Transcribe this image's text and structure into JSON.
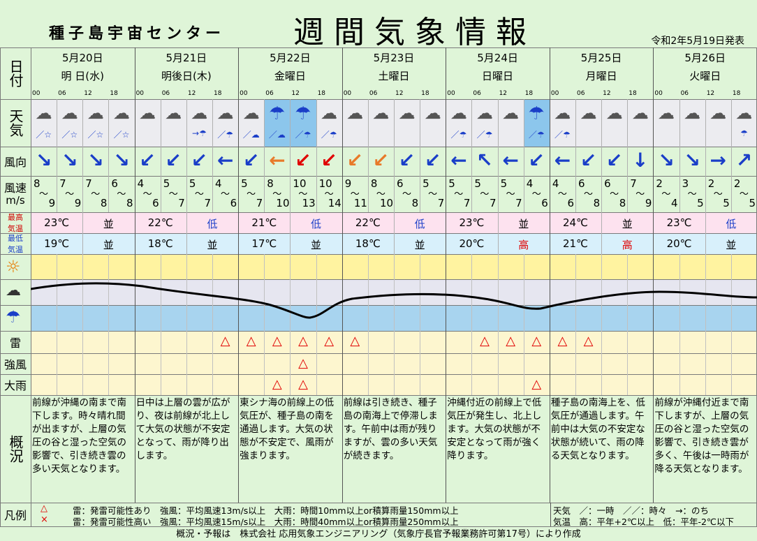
{
  "header": {
    "center_name": "種子島宇宙センター",
    "title": "週間気象情報",
    "issued": "令和2年5月19日発表"
  },
  "row_labels": {
    "date": "日付",
    "weather": "天気",
    "wind_dir": "風向",
    "wind_speed": "風速",
    "wind_speed_unit": "m/s",
    "max_temp": "最高気温",
    "min_temp": "最低気温",
    "thunder": "雷",
    "strong_wind": "強風",
    "heavy_rain": "大雨",
    "summary": "概況"
  },
  "hour_ticks": [
    "00",
    "06",
    "12",
    "18"
  ],
  "days": [
    {
      "date": "5月20日",
      "dow": "明 日(水)",
      "max_temp": "23℃",
      "max_rank": "並",
      "min_temp": "19℃",
      "min_rank": "並",
      "summary": "前線が沖縄の南まで南下します。時々晴れ間が出ますが、上層の気圧の谷と湿った空気の影響で、引き続き雲の多い天気となります。"
    },
    {
      "date": "5月21日",
      "dow": "明後日(木)",
      "max_temp": "22℃",
      "max_rank": "低",
      "min_temp": "18℃",
      "min_rank": "並",
      "summary": "日中は上層の雲が広がり、夜は前線が北上して大気の状態が不安定となって、雨が降り出します。"
    },
    {
      "date": "5月22日",
      "dow": "金曜日",
      "max_temp": "21℃",
      "max_rank": "低",
      "min_temp": "17℃",
      "min_rank": "並",
      "summary": "東シナ海の前線上の低気圧が、種子島の南を通過します。大気の状態が不安定で、風雨が強まります。"
    },
    {
      "date": "5月23日",
      "dow": "土曜日",
      "max_temp": "22℃",
      "max_rank": "低",
      "min_temp": "18℃",
      "min_rank": "並",
      "summary": "前線は引き続き、種子島の南海上で停滞します。午前中は雨が残りますが、雲の多い天気が続きます。"
    },
    {
      "date": "5月24日",
      "dow": "日曜日",
      "max_temp": "23℃",
      "max_rank": "並",
      "min_temp": "20℃",
      "min_rank": "高",
      "summary": "沖縄付近の前線上で低気圧が発生し、北上します。大気の状態が不安定となって雨が強く降ります。"
    },
    {
      "date": "5月25日",
      "dow": "月曜日",
      "max_temp": "24℃",
      "max_rank": "並",
      "min_temp": "21℃",
      "min_rank": "高",
      "summary": "種子島の南海上を、低気圧が通過します。午前中は大気の不安定な状態が続いて、雨の降る天気となります。"
    },
    {
      "date": "5月26日",
      "dow": "火曜日",
      "max_temp": "23℃",
      "max_rank": "低",
      "min_temp": "20℃",
      "min_rank": "並",
      "summary": "前線が沖縄付近まで南下しますが、上層の気圧の谷と湿った空気の影響で、引き続き雲が多く、午後は一時雨が降る天気となります。"
    }
  ],
  "slots": {
    "weather": [
      "cloud",
      "cloud",
      "cloud",
      "cloud",
      "cloud",
      "cloud",
      "cloud",
      "cloud",
      "cloud",
      "rain",
      "rain",
      "cloud",
      "cloud",
      "cloud",
      "cloud",
      "cloud",
      "cloud",
      "cloud",
      "cloud",
      "rain",
      "cloud",
      "cloud",
      "cloud",
      "cloud",
      "cloud",
      "cloud",
      "cloud",
      "cloud"
    ],
    "weather_sub": [
      "／☆",
      "／☆",
      "／☆",
      "／☆",
      "",
      "",
      "→☂",
      "／☂",
      "／☁",
      "／☁",
      "／☂",
      "／☂",
      "",
      "",
      "",
      "",
      "／☂",
      "／☂",
      "",
      "／☂",
      "／☂",
      "",
      "",
      "",
      "",
      "",
      "",
      "☂"
    ],
    "wind_arrow": [
      "↘",
      "↘",
      "↘",
      "↘",
      "↙",
      "↙",
      "↙",
      "←",
      "↙",
      "←",
      "↙",
      "↙",
      "↙",
      "↙",
      "↙",
      "↙",
      "←",
      "↖",
      "←",
      "↙",
      "←",
      "↙",
      "↙",
      "↓",
      "↘",
      "↘",
      "→",
      "↗"
    ],
    "wind_color": [
      "#1a3ec8",
      "#1a3ec8",
      "#1a3ec8",
      "#1a3ec8",
      "#1a3ec8",
      "#1a3ec8",
      "#1a3ec8",
      "#1a3ec8",
      "#1a3ec8",
      "#e87a2a",
      "#e00000",
      "#e00000",
      "#e87a2a",
      "#e87a2a",
      "#1a3ec8",
      "#1a3ec8",
      "#1a3ec8",
      "#1a3ec8",
      "#1a3ec8",
      "#1a3ec8",
      "#1a3ec8",
      "#1a3ec8",
      "#1a3ec8",
      "#1a3ec8",
      "#1a3ec8",
      "#1a3ec8",
      "#1a3ec8",
      "#1a3ec8"
    ],
    "wind_min": [
      "8",
      "7",
      "7",
      "6",
      "4",
      "5",
      "5",
      "4",
      "5",
      "8",
      "10",
      "10",
      "9",
      "8",
      "6",
      "5",
      "5",
      "5",
      "5",
      "4",
      "4",
      "6",
      "6",
      "7",
      "2",
      "3",
      "2",
      "2"
    ],
    "wind_max": [
      "9",
      "9",
      "8",
      "8",
      "6",
      "7",
      "7",
      "6",
      "7",
      "10",
      "13",
      "14",
      "11",
      "10",
      "8",
      "7",
      "7",
      "7",
      "7",
      "6",
      "6",
      "8",
      "8",
      "9",
      "4",
      "5",
      "5",
      "5"
    ],
    "thunder": [
      "",
      "",
      "",
      "",
      "",
      "",
      "",
      "△",
      "△",
      "△",
      "△",
      "△",
      "△",
      "",
      "",
      "",
      "",
      "△",
      "△",
      "△",
      "△",
      "△",
      "",
      "",
      "",
      "",
      "",
      ""
    ],
    "strong_wind": [
      "",
      "",
      "",
      "",
      "",
      "",
      "",
      "",
      "",
      "",
      "△",
      "",
      "",
      "",
      "",
      "",
      "",
      "",
      "",
      "",
      "",
      "",
      "",
      "",
      "",
      "",
      "",
      ""
    ],
    "heavy_rain": [
      "",
      "",
      "",
      "",
      "",
      "",
      "",
      "",
      "",
      "△",
      "△",
      "",
      "",
      "",
      "",
      "",
      "",
      "",
      "",
      "△",
      "",
      "",
      "",
      "",
      "",
      "",
      "",
      ""
    ]
  },
  "colors": {
    "sun_band": "#fff3a0",
    "cloud_band": "#e6e6f0",
    "rain_band": "#a8d4ef",
    "rain_highlight": "#8cc6ec",
    "max_row": "#fde2ef",
    "min_row": "#d8f0fb",
    "grid": "#7a7a7a",
    "triangle": "#e00000"
  },
  "legend": {
    "symbol_1": "△",
    "symbol_2": "×",
    "line_1": "雷：発雷可能性あり　強風：平均風速13m/s以上　大雨：時間10mm以上or積算雨量150mm以上",
    "line_2": "雷：発雷可能性高い　強風：平均風速15m/s以上　大雨：時間40mm以上or積算雨量250mm以上",
    "weather_key": "天気　／：一時　／／：時々　→：のち",
    "temp_key": "気温　高：平年+2℃以上　低：平年-2℃以下",
    "label": "凡例"
  },
  "footer": "概況・予報は　株式会社 応用気象エンジニアリング（気象庁長官予報業務許可第17号）により作成"
}
